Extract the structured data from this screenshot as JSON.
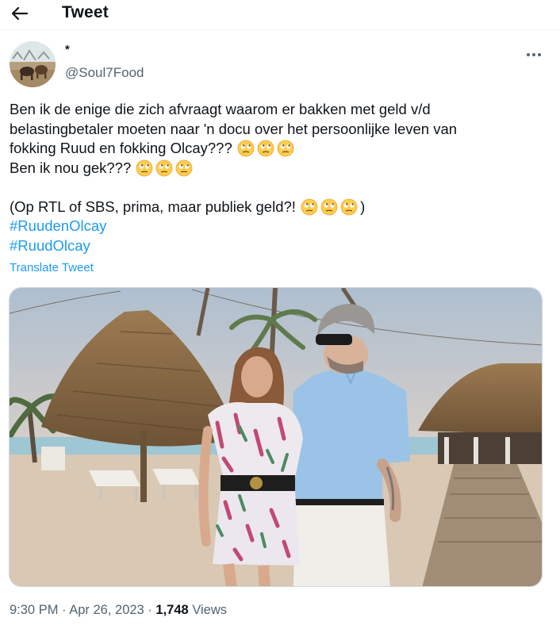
{
  "header": {
    "title": "Tweet",
    "back_icon": "arrow-left-icon"
  },
  "author": {
    "display_name": "*",
    "handle": "@Soul7Food",
    "avatar": "avatar-cows-photo"
  },
  "tweet": {
    "lines": [
      "Ben ik de enige die zich afvraagt waarom er bakken met geld v/d",
      "belastingbetaler moeten naar 'n docu over het persoonlijke leven van",
      "fokking Ruud en fokking Olcay???",
      "Ben ik nou gek???",
      "(Op RTL of SBS, prima, maar publiek geld?!",
      ")"
    ],
    "emoji": "face-with-rolling-eyes-icon",
    "hashtags": [
      "#RuudenOlcay",
      "#RuudOlcay"
    ],
    "translate_label": "Translate Tweet"
  },
  "media": {
    "description_icon": "photo-couple-at-beach"
  },
  "meta": {
    "time": "9:30 PM",
    "separator": "·",
    "date": "Apr 26, 2023",
    "views_count": "1,748",
    "views_label": "Views"
  },
  "colors": {
    "link": "#1d9bf0",
    "secondary": "#536471",
    "text": "#0f1419"
  }
}
